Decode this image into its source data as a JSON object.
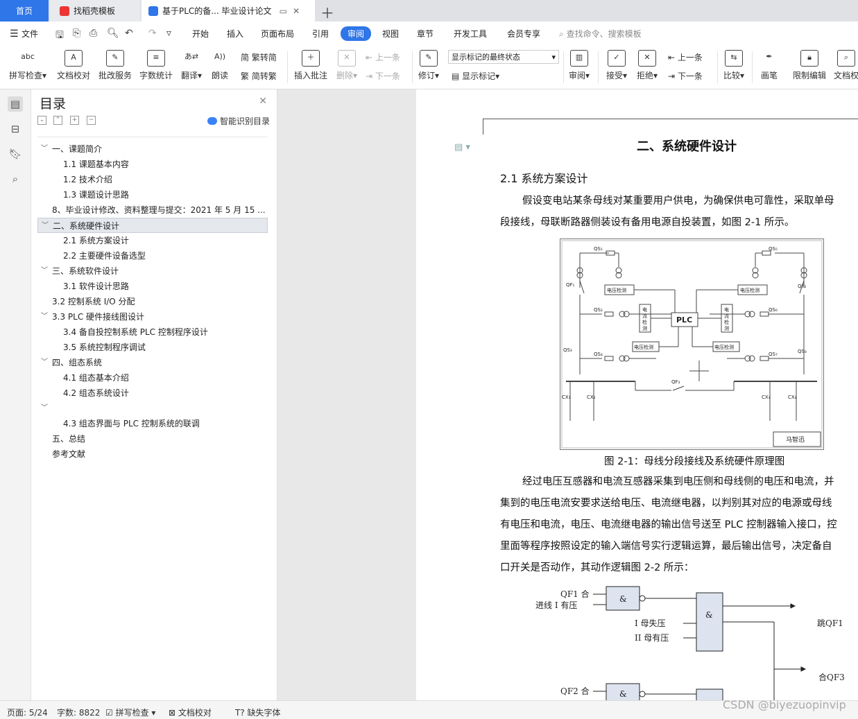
{
  "tabs": {
    "home": "首页",
    "template": "找稻壳模板",
    "document": "基于PLC的备... 毕业设计论文"
  },
  "menu": {
    "file": "文件",
    "items": [
      "开始",
      "插入",
      "页面布局",
      "引用",
      "审阅",
      "视图",
      "章节",
      "开发工具",
      "会员专享"
    ],
    "active": "审阅",
    "search_placeholder": "查找命令、搜索模板"
  },
  "ribbon": {
    "spell_check": "拼写检查",
    "doc_proof": "文档校对",
    "review_service": "批改服务",
    "word_count": "字数统计",
    "translate": "翻译",
    "read_aloud": "朗读",
    "trad_to_simp": "繁转简",
    "simp_to_trad": "简转繁",
    "insert_comment": "插入批注",
    "delete": "删除",
    "prev": "上一条",
    "next": "下一条",
    "track_changes": "修订",
    "markup_state": "显示标记的最终状态",
    "show_markup": "显示标记",
    "review": "审阅",
    "accept": "接受",
    "reject": "拒绝",
    "prev2": "上一条",
    "next2": "下一条",
    "compare": "比较",
    "pen": "画笔",
    "restrict_edit": "限制编辑",
    "doc_rights": "文档权"
  },
  "toc": {
    "title": "目录",
    "smart_recognize": "智能识别目录",
    "items": [
      {
        "label": "一、课题简介",
        "level": 1,
        "caret": true
      },
      {
        "label": "1.1  课题基本内容",
        "level": 2
      },
      {
        "label": "1.2  技术介绍",
        "level": 2
      },
      {
        "label": "1.3  课题设计思路",
        "level": 2
      },
      {
        "label": "8、毕业设计修改、资料整理与提交：2021 年 5 月 15 ...",
        "level": 1
      },
      {
        "label": "二、系统硬件设计",
        "level": 1,
        "caret": true,
        "selected": true
      },
      {
        "label": "2.1  系统方案设计",
        "level": 2
      },
      {
        "label": "2.2  主要硬件设备选型",
        "level": 2
      },
      {
        "label": "三、系统软件设计",
        "level": 1,
        "caret": true
      },
      {
        "label": "3.1  软件设计思路",
        "level": 2
      },
      {
        "label": "3.2  控制系统 I/O 分配",
        "level": 1
      },
      {
        "label": "3.3 PLC 硬件接线图设计",
        "level": 1,
        "caret": true
      },
      {
        "label": "3.4 备自投控制系统 PLC 控制程序设计",
        "level": 2
      },
      {
        "label": "3.5 系统控制程序调试",
        "level": 2
      },
      {
        "label": "四、组态系统",
        "level": 1,
        "caret": true
      },
      {
        "label": "4.1  组态基本介绍",
        "level": 2
      },
      {
        "label": "4.2 组态系统设计",
        "level": 2
      },
      {
        "label": "",
        "level": 1,
        "caret": true
      },
      {
        "label": "4.3 组态界面与 PLC 控制系统的联调",
        "level": 2
      },
      {
        "label": "五、总结",
        "level": 1
      },
      {
        "label": "参考文献",
        "level": 1
      }
    ]
  },
  "document": {
    "chapter_title": "二、系统硬件设计",
    "section_title": "2.1  系统方案设计",
    "para1": [
      "假设变电站某条母线对某重要用户供电，为确保供电可靠性，采取单母",
      "段接线，母联断路器侧装设有备用电源自投装置，如图 2-1 所示。"
    ],
    "fig1": {
      "caption": "图 2-1：母线分段接线及系统硬件原理图",
      "plc": "PLC",
      "volt_detect": "电压检测",
      "curr_detect": [
        "电",
        "流",
        "检",
        "测"
      ],
      "labels": [
        "QS1",
        "QS5",
        "QF1",
        "QF2",
        "QS2",
        "QS6",
        "QS3",
        "QS8",
        "QS4",
        "QS7",
        "QF3",
        "CX1",
        "CX2",
        "CX3",
        "CX4"
      ],
      "author": "马智迅"
    },
    "para2": [
      "经过电压互感器和电流互感器采集到电压侧和母线侧的电压和电流，并",
      "集到的电压电流安要求送给电压、电流继电器，以判别其对应的电源或母线",
      "有电压和电流，电压、电流继电器的输出信号送至 PLC 控制器输入接口，控",
      "里面等程序按照设定的输入端信号实行逻辑运算，最后输出信号，决定备自",
      "口开关是否动作，其动作逻辑图 2-2 所示："
    ],
    "fig2": {
      "qf1_close": "QF1 合",
      "line1_has_volt": "进线 I 有压",
      "bus1_lost": "I 母失压",
      "bus2_has": "II 母有压",
      "trip_qf1": "跳QF1",
      "close_qf3": "合QF3",
      "qf2_close": "QF2 合",
      "line2_has_volt": "进线 II 有压",
      "and": "&"
    }
  },
  "status": {
    "page": "页面: 5/24",
    "words": "字数: 8822",
    "spell": "拼写检查",
    "proof": "文档校对",
    "missing_font": "缺失字体"
  },
  "watermark": "CSDN @biyezuopinvip"
}
